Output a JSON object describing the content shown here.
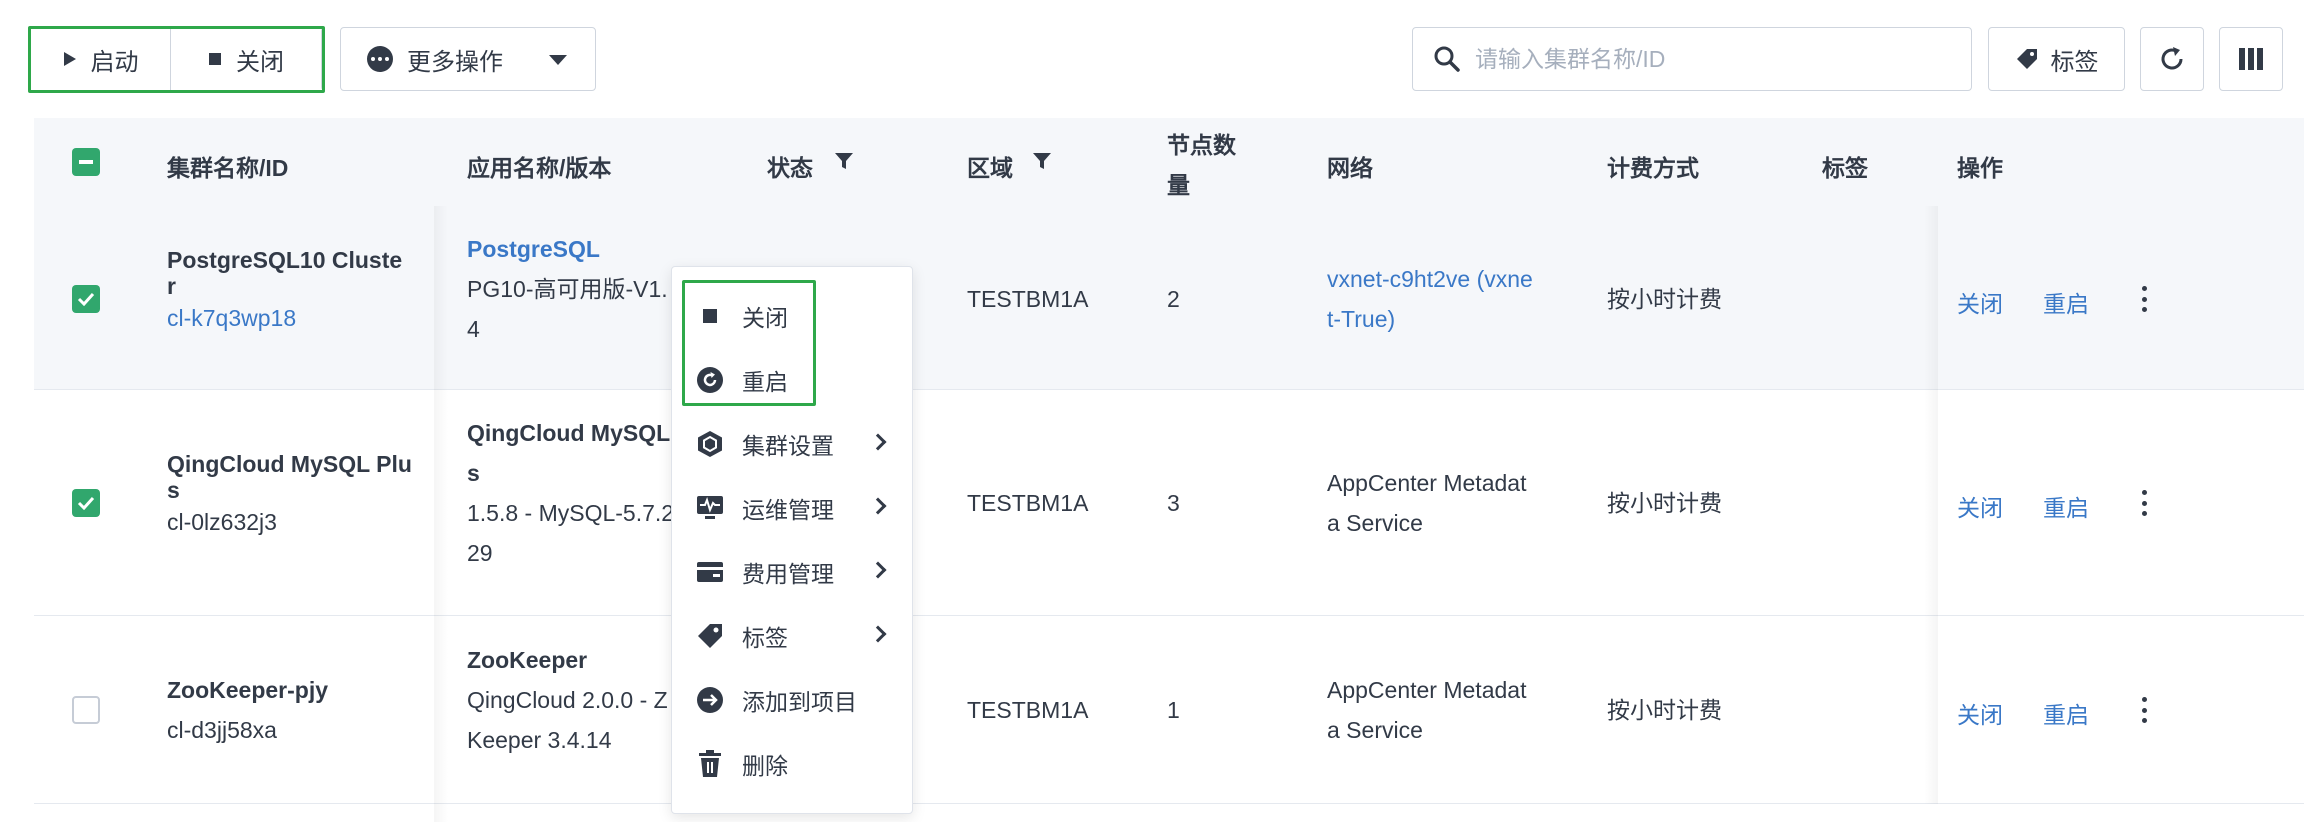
{
  "toolbar": {
    "start_label": "启动",
    "stop_label": "关闭",
    "more_label": "更多操作",
    "search_placeholder": "请输入集群名称/ID",
    "tag_label": "标签"
  },
  "table": {
    "headers": {
      "name": "集群名称/ID",
      "app": "应用名称/版本",
      "status": "状态",
      "zone": "区域",
      "nodes_line1": "节点数",
      "nodes_line2": "量",
      "network": "网络",
      "billing": "计费方式",
      "tags": "标签",
      "actions": "操作"
    },
    "rows": [
      {
        "checked": true,
        "name_line1": "PostgreSQL10 Cluste",
        "name_line2": "r",
        "id": "cl-k7q3wp18",
        "app_name": "PostgreSQL",
        "version_line1": "PG10-高可用版-V1.",
        "version_line2": "4",
        "zone": "TESTBM1A",
        "nodes": "2",
        "network_line1": "vxnet-c9ht2ve (vxne",
        "network_line2": "t-True)",
        "billing": "按小时计费",
        "action1": "关闭",
        "action2": "重启"
      },
      {
        "checked": true,
        "name_line1": "QingCloud MySQL Plu",
        "name_line2": "s",
        "id": "cl-0lz632j3",
        "app_name_line1": "QingCloud MySQL I",
        "app_name_line2": "s",
        "version_line1": "1.5.8 - MySQL-5.7.2",
        "version_line2": "29",
        "zone": "TESTBM1A",
        "nodes": "3",
        "network_line1": "AppCenter Metadat",
        "network_line2": "a Service",
        "billing": "按小时计费",
        "action1": "关闭",
        "action2": "重启"
      },
      {
        "checked": false,
        "name_line1": "ZooKeeper-pjy",
        "id": "cl-d3jj58xa",
        "app_name": "ZooKeeper",
        "version_line1": "QingCloud 2.0.0 - Z",
        "version_line2": "Keeper 3.4.14",
        "zone": "TESTBM1A",
        "nodes": "1",
        "network_line1": "AppCenter Metadat",
        "network_line2": "a Service",
        "billing": "按小时计费",
        "action1": "关闭",
        "action2": "重启"
      }
    ]
  },
  "context_menu": {
    "items": [
      {
        "label": "关闭",
        "icon": "stop-icon",
        "submenu": false
      },
      {
        "label": "重启",
        "icon": "restart-icon",
        "submenu": false
      },
      {
        "label": "集群设置",
        "icon": "cube-icon",
        "submenu": true
      },
      {
        "label": "运维管理",
        "icon": "monitor-icon",
        "submenu": true
      },
      {
        "label": "费用管理",
        "icon": "wallet-icon",
        "submenu": true
      },
      {
        "label": "标签",
        "icon": "tag-icon",
        "submenu": true
      },
      {
        "label": "添加到项目",
        "icon": "add-to-project-icon",
        "submenu": false
      },
      {
        "label": "删除",
        "icon": "trash-icon",
        "submenu": false
      }
    ]
  },
  "colors": {
    "accent_green": "#2ea84a",
    "checkbox_green": "#31a76d",
    "link_blue": "#3a78c7",
    "text": "#323a47"
  }
}
